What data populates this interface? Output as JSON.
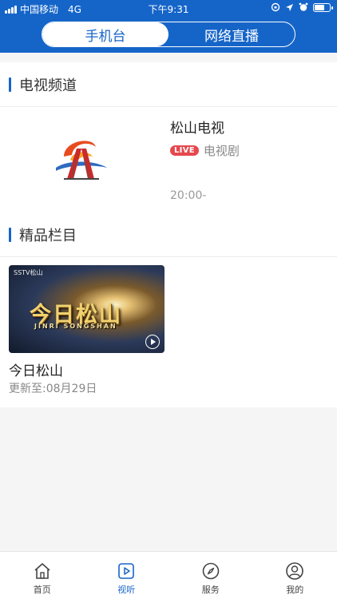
{
  "status_bar": {
    "carrier": "中国移动",
    "network": "4G",
    "time": "下午9:31"
  },
  "segmented_tabs": [
    {
      "label": "手机台",
      "active": true
    },
    {
      "label": "网络直播",
      "active": false
    }
  ],
  "tv_section": {
    "title": "电视频道",
    "channel": {
      "name": "松山电视",
      "live_badge": "LIVE",
      "program": "电视剧",
      "time": "20:00-"
    }
  },
  "featured_section": {
    "title": "精品栏目",
    "card": {
      "thumb_watermark": "SSTV松山",
      "thumb_title": "今日松山",
      "thumb_subtitle": "JINRI SONGSHAN",
      "title": "今日松山",
      "updated": "更新至:08月29日"
    }
  },
  "bottom_nav": [
    {
      "label": "首页",
      "icon": "home-icon",
      "active": false
    },
    {
      "label": "视听",
      "icon": "play-icon",
      "active": true
    },
    {
      "label": "服务",
      "icon": "compass-icon",
      "active": false
    },
    {
      "label": "我的",
      "icon": "user-icon",
      "active": false
    }
  ],
  "colors": {
    "brand_blue": "#1565c9",
    "live_red": "#e5484d",
    "page_bg": "#f5f5f5"
  }
}
